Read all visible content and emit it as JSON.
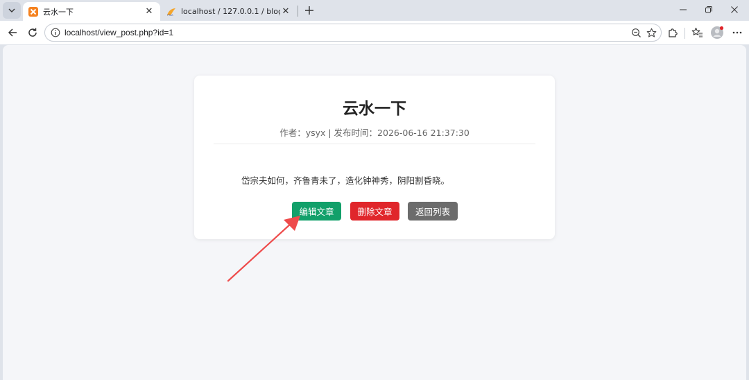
{
  "browser": {
    "tabs": [
      {
        "title": "云水一下",
        "active": true
      },
      {
        "title": "localhost / 127.0.0.1 / blog / users",
        "active": false
      }
    ],
    "address_bar": {
      "url": "localhost/view_post.php?id=1"
    },
    "icons": {
      "tab_list": "chevron-down-icon",
      "new_tab": "plus-icon",
      "back": "arrow-left-icon",
      "reload": "reload-icon",
      "site_info": "info-icon",
      "zoom": "zoom-icon",
      "favorite": "star-icon",
      "extensions": "puzzle-icon",
      "favorites_bar": "favorites-icon",
      "profile": "avatar",
      "more": "ellipsis-icon"
    }
  },
  "post": {
    "title": "云水一下",
    "meta": "作者：ysyx | 发布时间：2026-06-16 21:37:30",
    "content": "岱宗夫如何，齐鲁青未了，造化钟神秀，阴阳割昏晓。",
    "buttons": {
      "edit": "编辑文章",
      "delete": "删除文章",
      "back": "返回列表"
    }
  },
  "colors": {
    "edit_button": "#12a06a",
    "delete_button": "#e0262b",
    "back_button": "#6c6c6c",
    "annotation_arrow": "#ee4b4b",
    "page_background": "#f5f6f9"
  }
}
